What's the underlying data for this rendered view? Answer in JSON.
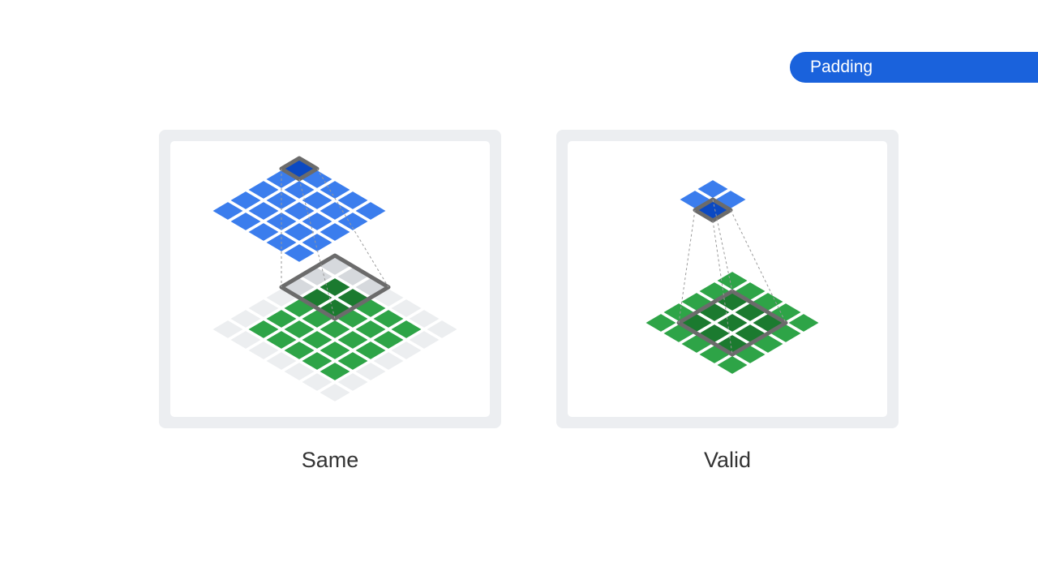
{
  "tag": {
    "label": "Padding"
  },
  "panels": [
    {
      "caption": "Same"
    },
    {
      "caption": "Valid"
    }
  ],
  "colors": {
    "tag_bg": "#1a62dc",
    "output_cell": "#3b7ded",
    "output_cell_active": "#0b49c2",
    "input_cell": "#2ea447",
    "input_cell_active": "#1b7a2f",
    "padding_cell": "#eceef0",
    "padding_cell_active": "#d6d9dd",
    "kernel_outline": "#6b6b6b",
    "guide_line": "#9a9a9a"
  }
}
